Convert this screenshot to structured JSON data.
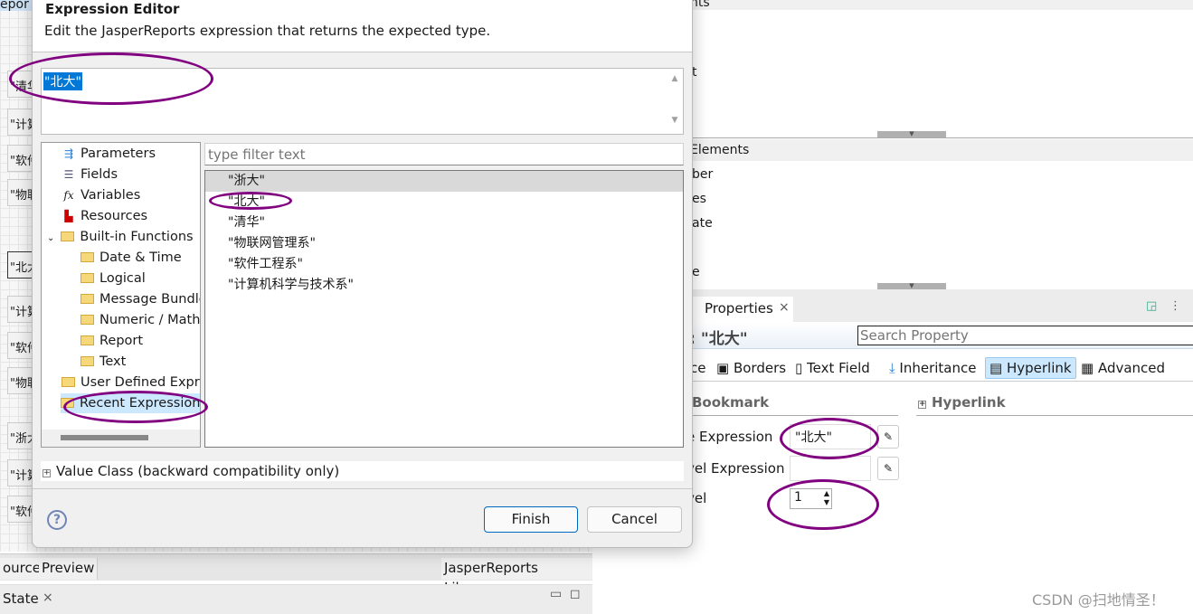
{
  "background_editor": {
    "top_tab_fragment": "epor",
    "cells": [
      "\"清华",
      "\"计算",
      "\"软件",
      "\"物联",
      "\"北大",
      "\"计算",
      "\"软件",
      "\"物联",
      "\"浙大",
      "\"计算",
      "\"软件"
    ],
    "bottom_tabs": [
      "ource",
      "Preview"
    ],
    "library_label": "JasperReports Library",
    "state_tab": "State"
  },
  "right_panels": {
    "top_header_fragment": "nts",
    "top_item_fragment": "t",
    "elements_header": "Elements",
    "elements_items": [
      "ber",
      "es",
      "ate",
      "e"
    ],
    "properties_tab": "Properties",
    "element_title": "d: \"北大\"",
    "search_placeholder": "Search Property",
    "tabs": [
      "ce",
      "Borders",
      "Text Field",
      "Inheritance",
      "Hyperlink",
      "Advanced"
    ],
    "active_tab": "Hyperlink",
    "bookmark_section": "Bookmark",
    "hyperlink_section": "Hyperlink",
    "fields": {
      "anchor_label": "e Expression",
      "anchor_value": "\"北大\"",
      "level_expr_label": "vel Expression",
      "level_expr_value": "",
      "level_label": "vel",
      "level_value": "1"
    }
  },
  "dialog": {
    "title": "Expression Editor",
    "description": "Edit the JasperReports expression that returns the expected type.",
    "expression": "\"北大\"",
    "tree": [
      {
        "label": "Parameters",
        "icon": "parameters-icon"
      },
      {
        "label": "Fields",
        "icon": "fields-icon"
      },
      {
        "label": "Variables",
        "icon": "fx-icon"
      },
      {
        "label": "Resources",
        "icon": "resources-icon"
      },
      {
        "label": "Built-in Functions",
        "icon": "folder-icon",
        "expanded": true
      },
      {
        "label": "Date & Time",
        "icon": "folder-icon"
      },
      {
        "label": "Logical",
        "icon": "folder-icon"
      },
      {
        "label": "Message Bundle",
        "icon": "folder-icon"
      },
      {
        "label": "Numeric / Math",
        "icon": "folder-icon"
      },
      {
        "label": "Report",
        "icon": "folder-icon"
      },
      {
        "label": "Text",
        "icon": "folder-icon"
      },
      {
        "label": "User Defined Expressions",
        "icon": "folder-icon"
      },
      {
        "label": "Recent Expressions",
        "icon": "folder-icon",
        "selected": true
      }
    ],
    "filter_placeholder": "type filter text",
    "recent_expressions": [
      "\"浙大\"",
      "\"北大\"",
      "\"清华\"",
      "\"物联网管理系\"",
      "\"软件工程系\"",
      "\"计算机科学与技术系\""
    ],
    "value_class_label": "Value Class (backward compatibility only)",
    "finish_label": "Finish",
    "cancel_label": "Cancel"
  },
  "watermark": "CSDN @扫地情圣！",
  "colors": {
    "annotation": "#800080",
    "selection": "#0078d7",
    "tab_active": "#cce8ff"
  }
}
